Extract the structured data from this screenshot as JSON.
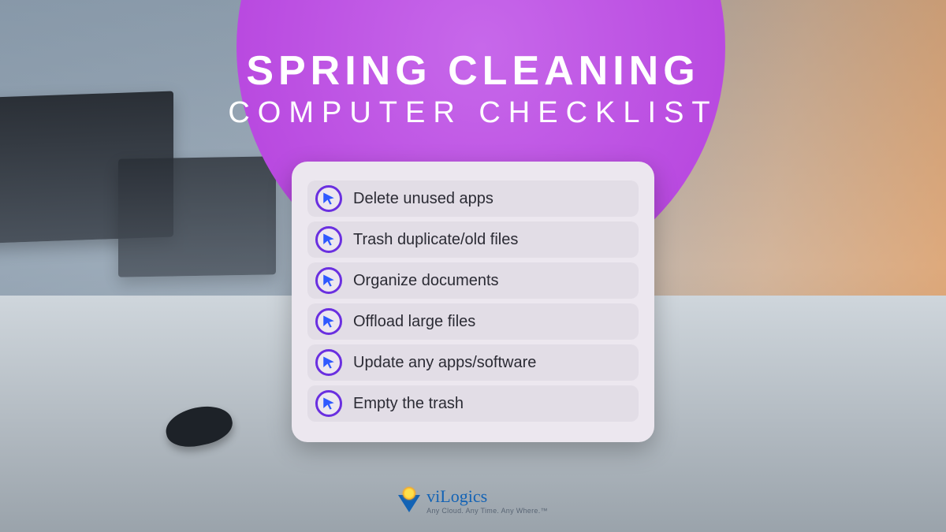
{
  "heading": {
    "title": "SPRING CLEANING",
    "subtitle": "COMPUTER CHECKLIST"
  },
  "checklist": {
    "items": [
      {
        "label": "Delete unused apps"
      },
      {
        "label": "Trash duplicate/old files"
      },
      {
        "label": "Organize documents"
      },
      {
        "label": "Offload large files"
      },
      {
        "label": "Update any apps/software"
      },
      {
        "label": "Empty the trash"
      }
    ]
  },
  "brand": {
    "name": "viLogics",
    "tagline": "Any Cloud. Any Time. Any Where.™"
  },
  "colors": {
    "accent_purple": "#b94ae0",
    "cursor_blue": "#2f59ff",
    "ring_purple": "#6a2fe0",
    "brand_blue": "#1363b5"
  }
}
